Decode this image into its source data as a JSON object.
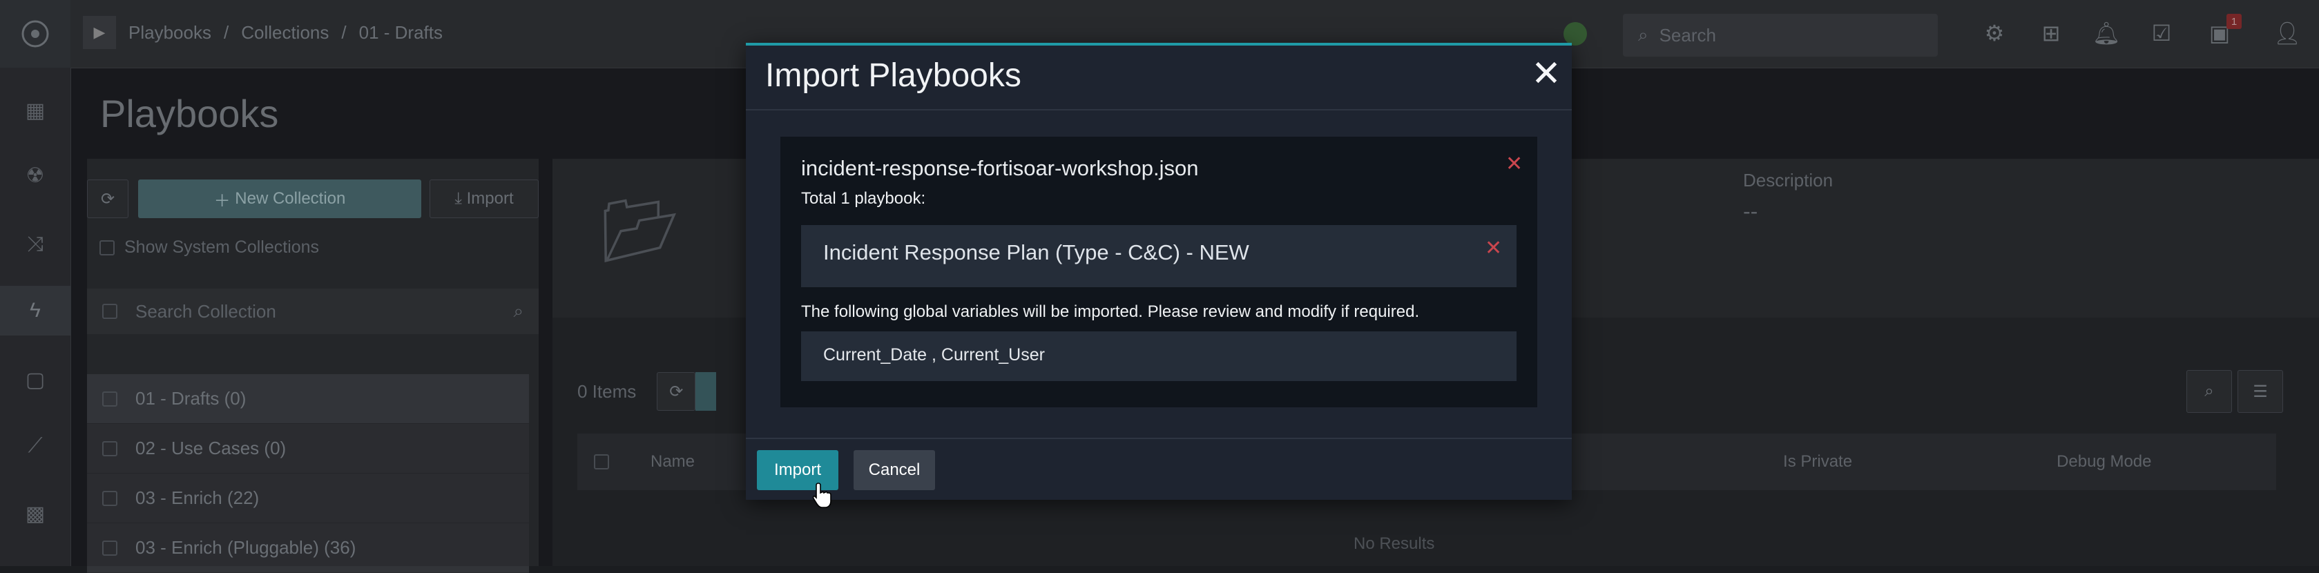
{
  "topbar": {
    "breadcrumb": [
      "Playbooks",
      "Collections",
      "01 - Drafts"
    ],
    "breadcrumb_sep": "/",
    "search_placeholder": "Search",
    "notification_count": "1"
  },
  "page": {
    "title": "Playbooks"
  },
  "left_panel": {
    "new_collection_label": "New Collection",
    "import_label": "Import",
    "show_system_label": "Show System Collections",
    "search_placeholder": "Search Collection",
    "collections": [
      {
        "label": "01 - Drafts (0)"
      },
      {
        "label": "02 - Use Cases (0)"
      },
      {
        "label": "03 - Enrich (22)"
      },
      {
        "label": "03 - Enrich (Pluggable) (36)"
      }
    ]
  },
  "content": {
    "description_label": "Description",
    "description_value": "--",
    "items_count": "0 Items",
    "columns": [
      "Name",
      "Is Private",
      "Debug Mode"
    ],
    "no_results": "No Results"
  },
  "modal": {
    "title": "Import Playbooks",
    "close_glyph": "✕",
    "file_name": "incident-response-fortisoar-workshop.json",
    "total_text": "Total 1 playbook:",
    "playbooks": [
      {
        "name": "Incident Response Plan (Type - C&C) - NEW"
      }
    ],
    "global_vars_note": "The following global variables will be imported. Please review and modify if required.",
    "global_vars": "Current_Date , Current_User",
    "import_button": "Import",
    "cancel_button": "Cancel"
  },
  "colors": {
    "accent": "#1f9aa6",
    "import_button": "#1f8a98",
    "remove_x": "#c9464e"
  }
}
